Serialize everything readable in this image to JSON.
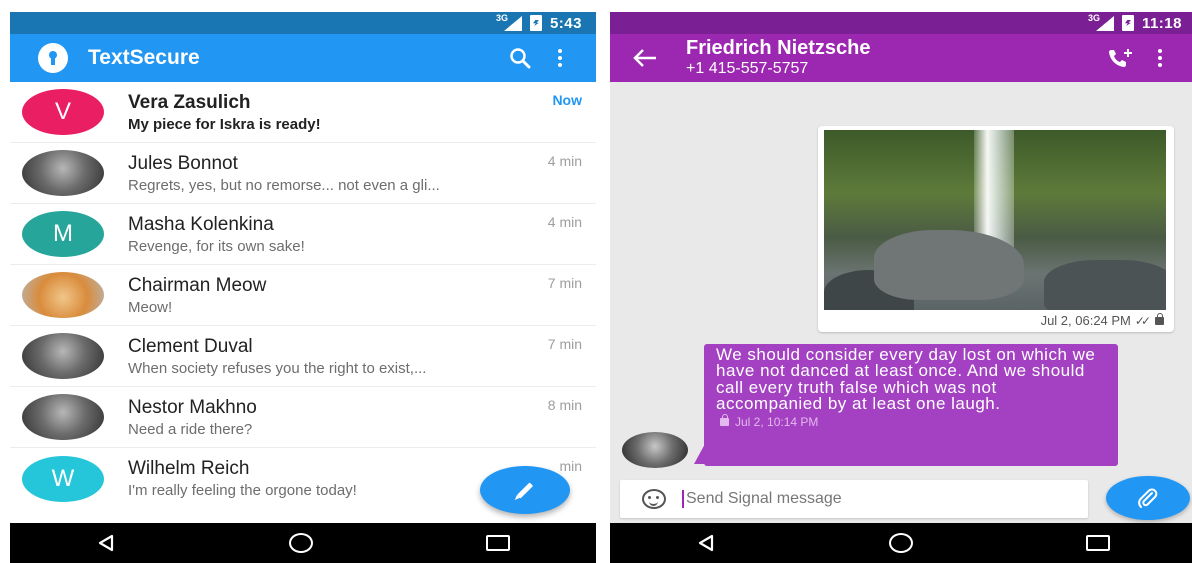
{
  "left": {
    "status_bar": {
      "network": "3G",
      "time": "5:43"
    },
    "app_title": "TextSecure",
    "conversations": [
      {
        "name": "Vera Zasulich",
        "snippet": "My piece for Iskra is ready!",
        "time": "Now",
        "avatar_letter": "V",
        "avatar_color": "#e91e63",
        "unread": true
      },
      {
        "name": "Jules Bonnot",
        "snippet": "Regrets, yes, but no remorse... not even a gli...",
        "time": "4 min",
        "avatar_letter": "",
        "avatar_color": "#5a5a5a",
        "unread": false
      },
      {
        "name": "Masha Kolenkina",
        "snippet": "Revenge, for its own sake!",
        "time": "4 min",
        "avatar_letter": "M",
        "avatar_color": "#26a69a",
        "unread": false
      },
      {
        "name": "Chairman Meow",
        "snippet": "Meow!",
        "time": "7 min",
        "avatar_letter": "",
        "avatar_color": "#d98c3c",
        "unread": false
      },
      {
        "name": "Clement Duval",
        "snippet": "When society refuses you the right to exist,...",
        "time": "7 min",
        "avatar_letter": "",
        "avatar_color": "#4a4a4a",
        "unread": false
      },
      {
        "name": "Nestor Makhno",
        "snippet": "Need a ride there?",
        "time": "8 min",
        "avatar_letter": "",
        "avatar_color": "#4a4a4a",
        "unread": false
      },
      {
        "name": "Wilhelm Reich",
        "snippet": "I'm really feeling the orgone today!",
        "time": "min",
        "avatar_letter": "W",
        "avatar_color": "#26c6da",
        "unread": false
      }
    ]
  },
  "right": {
    "status_bar": {
      "network": "3G",
      "time": "11:18"
    },
    "contact_name": "Friedrich Nietzsche",
    "contact_number": "+1 415-557-5757",
    "image_message": {
      "timestamp": "Jul 2, 06:24 PM"
    },
    "text_message": {
      "body": "We should consider every day lost on which we have not danced at least once. And we should call every truth false which was not accompanied by at least one laugh.",
      "timestamp": "Jul 2, 10:14 PM"
    },
    "composer_placeholder": "Send Signal message"
  },
  "icons": {
    "search": "search-icon",
    "overflow": "more-vert-icon",
    "compose": "pencil-icon",
    "call": "phone-icon",
    "attach": "paperclip-icon",
    "emoji": "smiley-icon"
  },
  "colors": {
    "textsecure_primary": "#2196f3",
    "textsecure_dark": "#1976b2",
    "signal_primary": "#9c27b0",
    "signal_dark": "#7b1f95",
    "bubble": "#a341c2"
  }
}
